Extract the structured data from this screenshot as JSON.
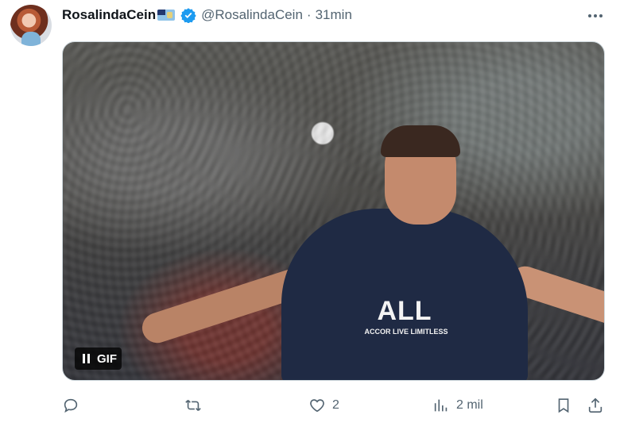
{
  "tweet": {
    "display_name": "RosalindaCein",
    "handle": "@RosalindaCein",
    "separator": "·",
    "time": "31min"
  },
  "media": {
    "gif_label": "GIF",
    "sponsor_text": "ALL",
    "sponsor_subtext": "ACCOR LIVE LIMITLESS"
  },
  "actions": {
    "reply_count": "",
    "retweet_count": "",
    "like_count": "2",
    "views_count": "2 mil"
  },
  "colors": {
    "verified": "#1d9bf0",
    "secondary_text": "#536471"
  },
  "icons": [
    "more-icon",
    "verified-icon",
    "flag-icon",
    "pause-icon",
    "reply-icon",
    "retweet-icon",
    "like-icon",
    "views-icon",
    "bookmark-icon",
    "share-icon"
  ]
}
